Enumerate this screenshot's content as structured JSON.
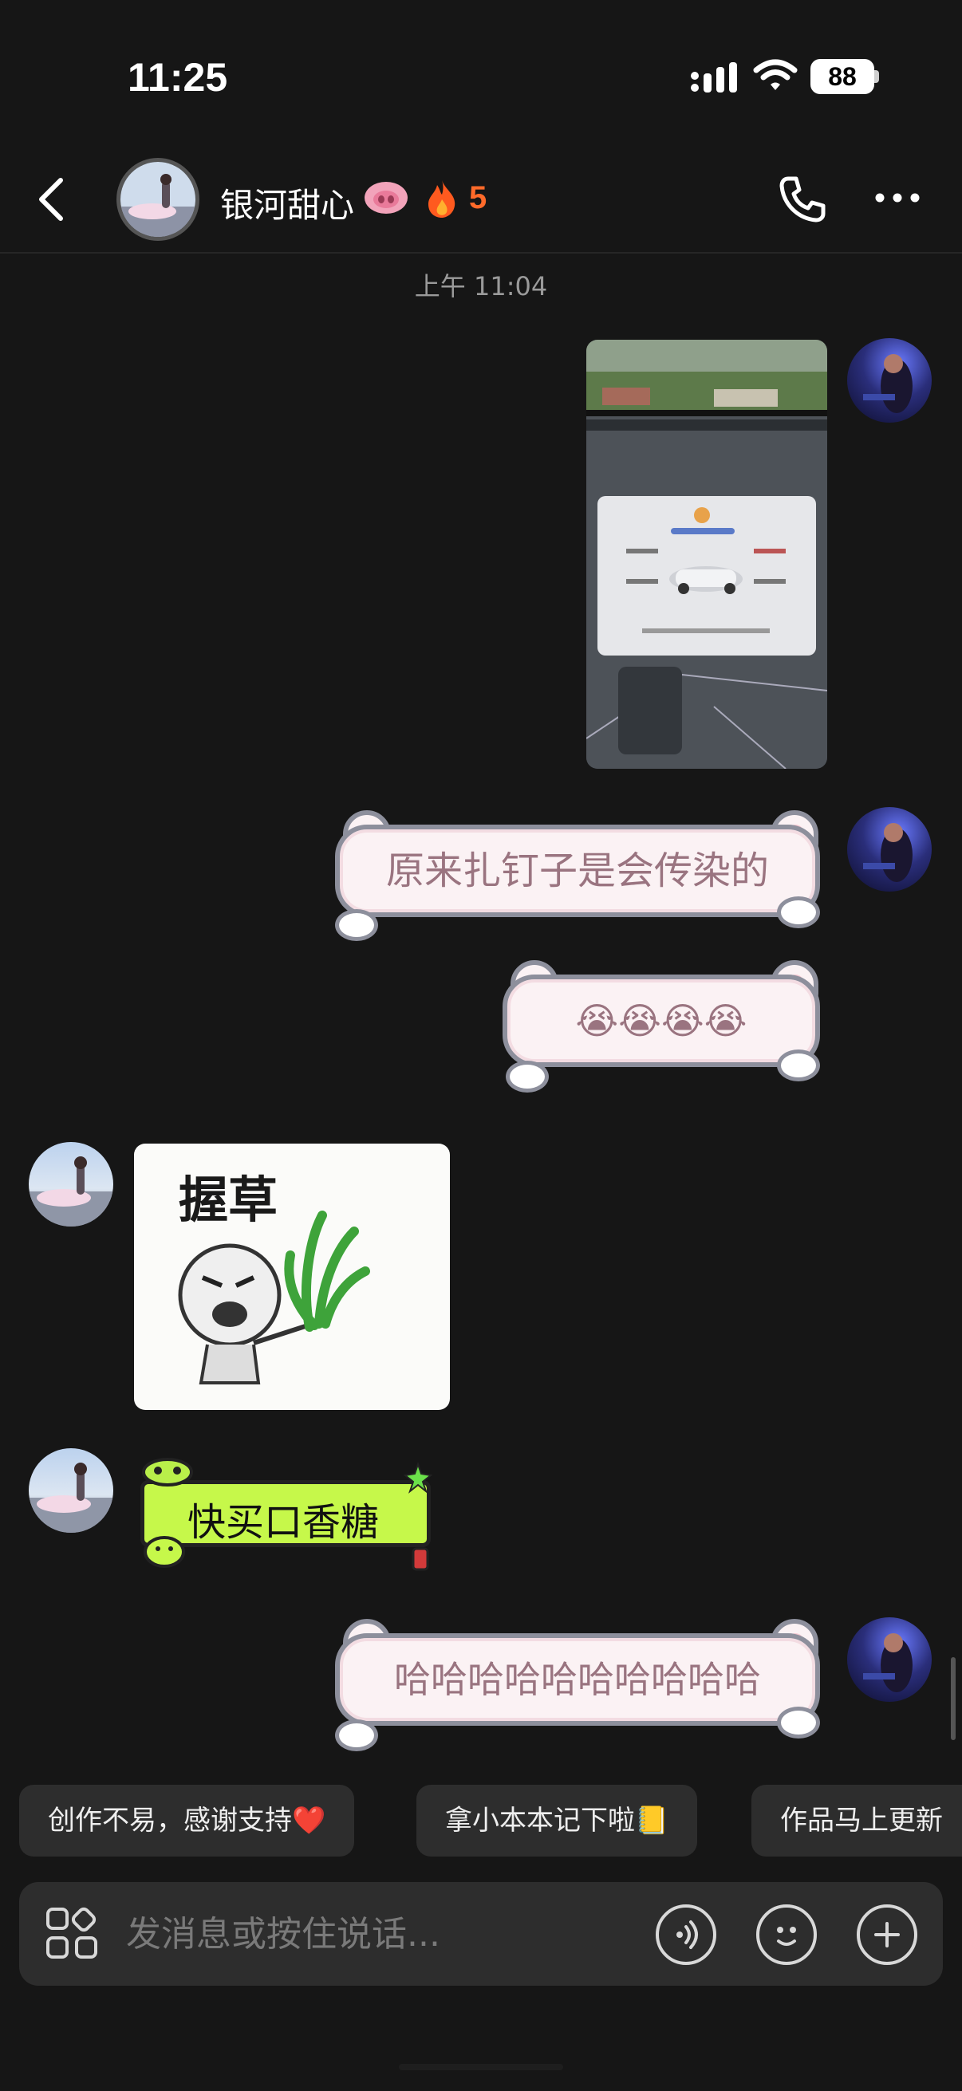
{
  "status_bar": {
    "time": "11:25",
    "battery": "88"
  },
  "header": {
    "contact_name": "银河甜心",
    "streak_count": "5",
    "icons": [
      "back-icon",
      "phone-icon",
      "more-icon",
      "pig-emoji-icon",
      "flame-icon"
    ]
  },
  "timestamp": "上午 11:04",
  "messages": {
    "m2": "原来扎钉子是会传染的",
    "m3": "😭😭😭😭",
    "m4_sticker_text": "握草",
    "m5": "快买口香糖",
    "m6": "哈哈哈哈哈哈哈哈哈哈"
  },
  "suggestions": [
    "创作不易，感谢支持❤️",
    "拿小本本记下啦📒",
    "作品马上更新"
  ],
  "input": {
    "placeholder": "发消息或按住说话..."
  },
  "colors": {
    "background": "#161616",
    "bubble": "#fbf2f4",
    "bubble_text": "#9a7480",
    "streak": "#ff6a2a",
    "sticker_green": "#c6f84a"
  }
}
